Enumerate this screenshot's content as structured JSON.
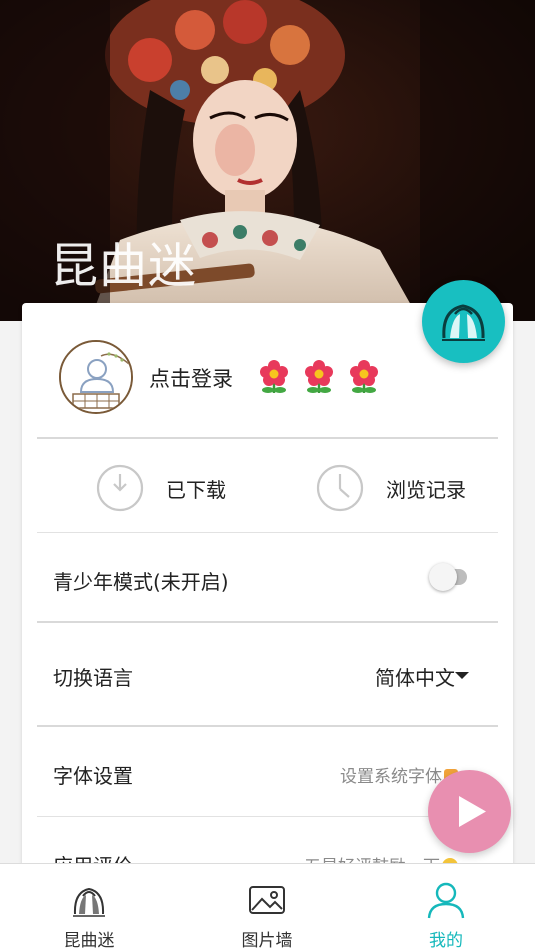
{
  "hero": {
    "title": "昆曲迷"
  },
  "profile": {
    "login_label": "点击登录"
  },
  "quick_actions": [
    {
      "label": "已下载",
      "icon": "download-icon"
    },
    {
      "label": "浏览记录",
      "icon": "history-clock-icon"
    }
  ],
  "settings": {
    "teen_mode": {
      "label": "青少年模式(未开启)",
      "enabled": false
    },
    "language": {
      "label": "切换语言",
      "value": "简体中文"
    },
    "font": {
      "label": "字体设置",
      "value": "设置系统字体"
    },
    "rating": {
      "label": "应用评价",
      "value": "五星好评鼓励一下"
    }
  },
  "bottom_nav": [
    {
      "label": "昆曲迷",
      "icon": "opera-logo-icon",
      "active": false
    },
    {
      "label": "图片墙",
      "icon": "image-icon",
      "active": false
    },
    {
      "label": "我的",
      "icon": "user-icon",
      "active": true
    }
  ],
  "colors": {
    "accent": "#15b8bb",
    "play_fab": "#e88fb0",
    "logo_fab": "#18bfc1"
  }
}
